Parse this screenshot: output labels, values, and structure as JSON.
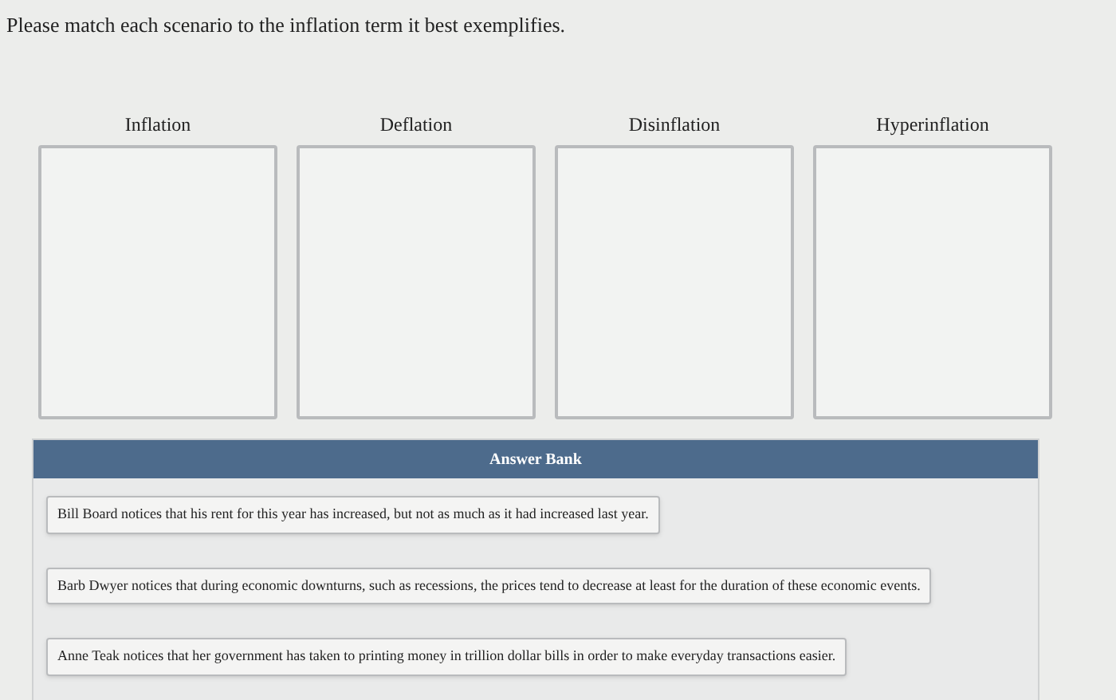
{
  "instruction": "Please match each scenario to the inflation term it best exemplifies.",
  "targets": [
    {
      "label": "Inflation"
    },
    {
      "label": "Deflation"
    },
    {
      "label": "Disinflation"
    },
    {
      "label": "Hyperinflation"
    }
  ],
  "answer_bank": {
    "title": "Answer Bank",
    "cards": [
      "Bill Board notices that his rent for this year has increased, but not as much as it had increased last year.",
      "Barb Dwyer notices that during economic downturns, such as recessions, the prices tend to decrease at least for the duration of these economic events.",
      "Anne Teak notices that her government has taken to printing money in trillion dollar bills in order to make everyday transactions easier."
    ]
  }
}
